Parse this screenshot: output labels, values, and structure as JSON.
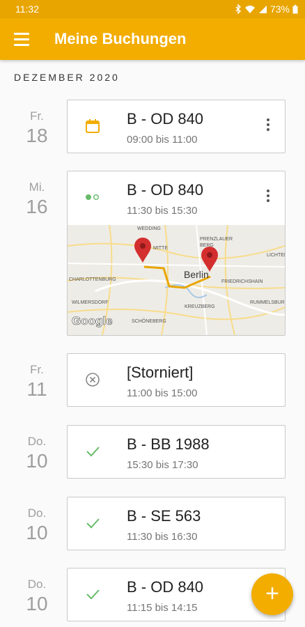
{
  "status_bar": {
    "time": "11:32",
    "battery": "73%",
    "icons": [
      "bluetooth-icon",
      "wifi-icon",
      "signal-icon",
      "battery-icon"
    ]
  },
  "app_bar": {
    "title": "Meine Buchungen",
    "menu_icon": "hamburger-menu-icon"
  },
  "month_header": "DEZEMBER 2020",
  "bookings": [
    {
      "weekday": "Fr.",
      "day": "18",
      "plate": "B - OD 840",
      "times": "09:00 bis 11:00",
      "status_icon": "calendar-icon",
      "has_menu": true
    },
    {
      "weekday": "Mi.",
      "day": "16",
      "plate": "B - OD 840",
      "times": "11:30 bis 15:30",
      "status_icon": "in-progress-dots-icon",
      "has_menu": true,
      "map": {
        "labels": [
          "WEDDING",
          "PRENZLAUER BERG",
          "MITTE",
          "Berlin",
          "CHARLOTTENBURG",
          "FRIEDRICHSHAIN",
          "LICHTENBERG",
          "KREUZBERG",
          "SCHÖNEBERG",
          "RUMMELSBURG",
          "WILMERSDORF"
        ],
        "logo": "Google"
      }
    },
    {
      "weekday": "Fr.",
      "day": "11",
      "plate": "[Storniert]",
      "times": "11:00 bis 15:00",
      "status_icon": "cancelled-circle-x-icon",
      "has_menu": false
    },
    {
      "weekday": "Do.",
      "day": "10",
      "plate": "B - BB 1988",
      "times": "15:30 bis 17:30",
      "status_icon": "check-icon",
      "has_menu": false
    },
    {
      "weekday": "Do.",
      "day": "10",
      "plate": "B - SE 563",
      "times": "11:30 bis 16:30",
      "status_icon": "check-icon",
      "has_menu": false
    },
    {
      "weekday": "Do.",
      "day": "10",
      "plate": "B - OD 840",
      "times": "11:15 bis 14:15",
      "status_icon": "check-icon",
      "has_menu": false
    }
  ],
  "fab": {
    "label": "+",
    "icon": "add-icon"
  },
  "colors": {
    "primary": "#f2ad00",
    "status_bar": "#e8a500",
    "check": "#66bb6a",
    "dots": "#66bb6a",
    "route": "#e8a500",
    "pin": "#d32f2f"
  }
}
